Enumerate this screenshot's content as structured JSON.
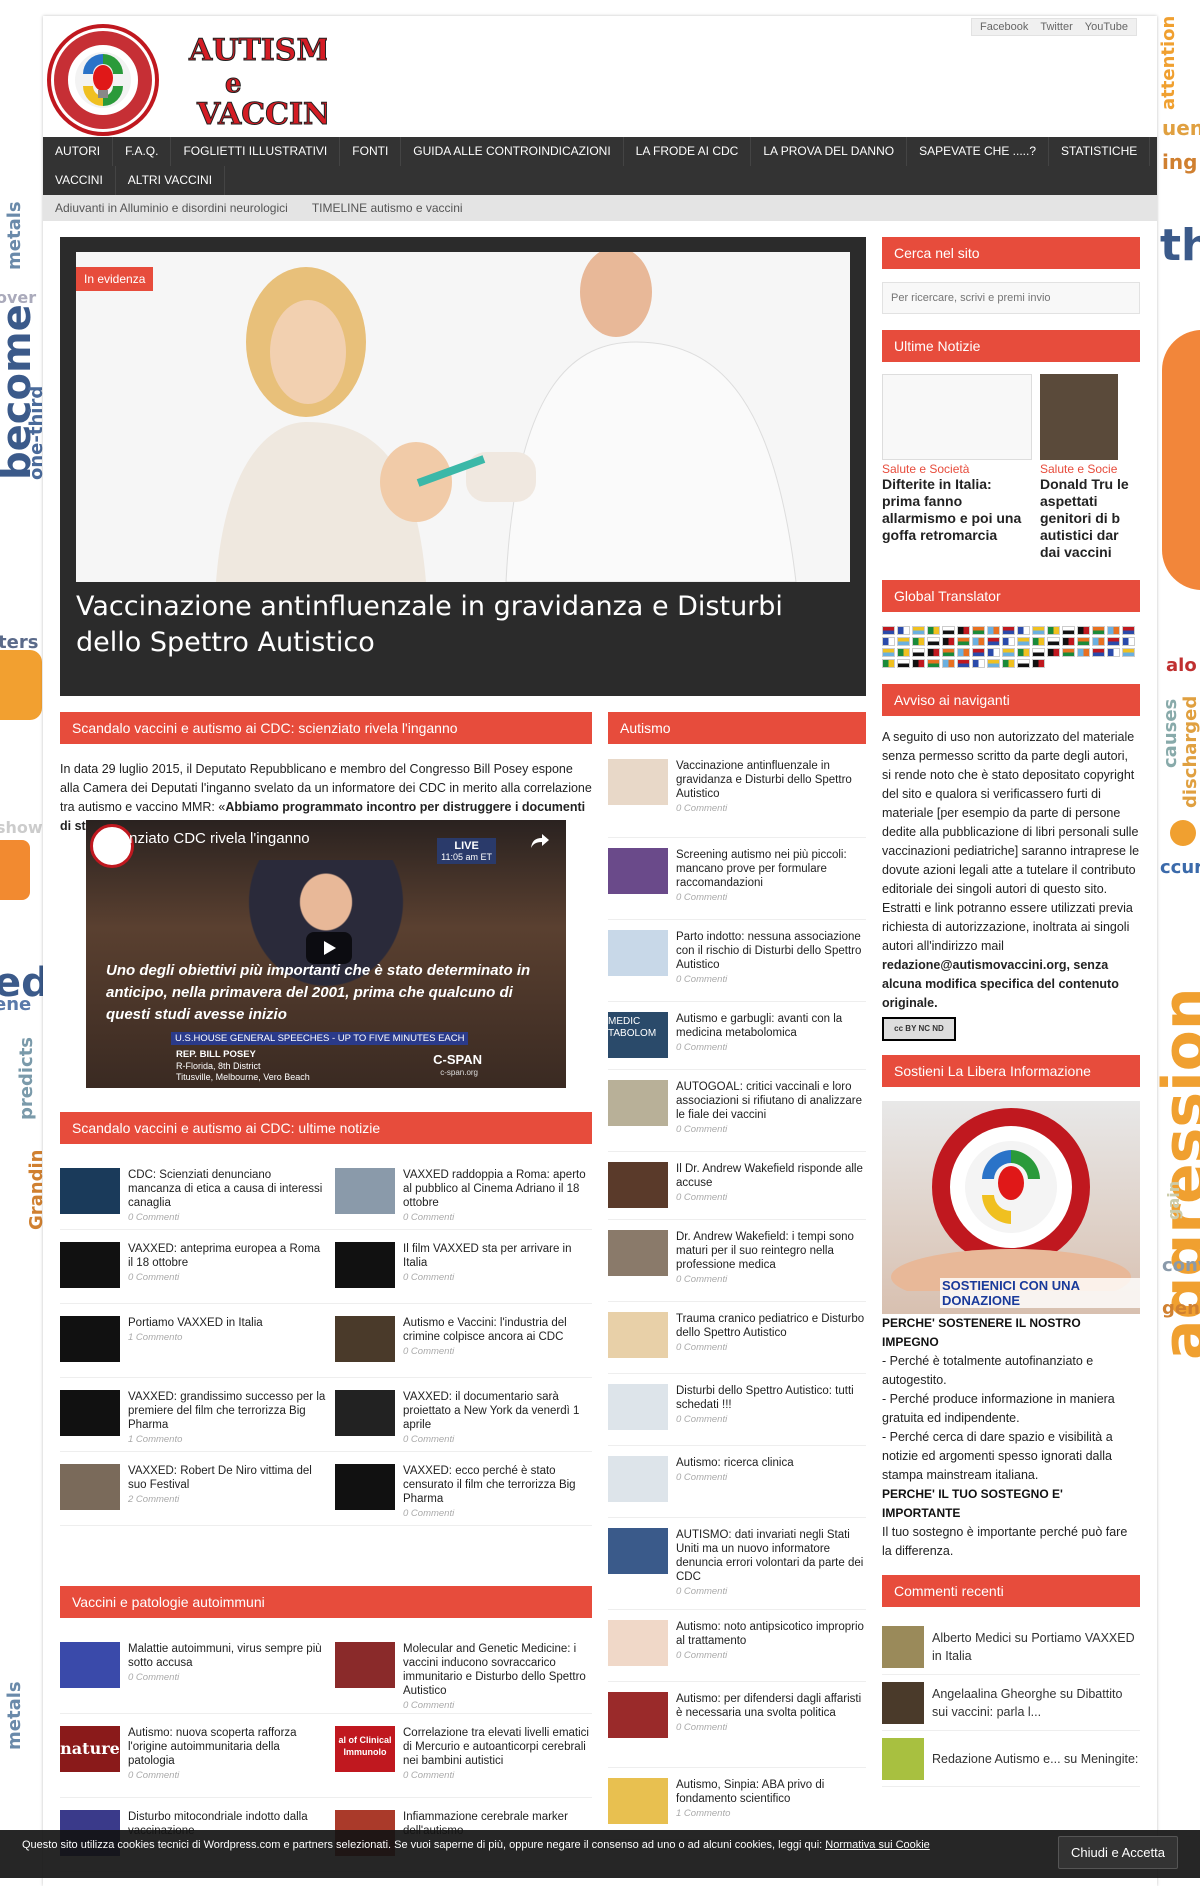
{
  "background_words": [
    "attention",
    "become",
    "one-third",
    "metals",
    "over",
    "causes",
    "discharged",
    "aggression",
    "show",
    "ters",
    "ene",
    "predicts",
    "Grandin",
    "show",
    "alo",
    "gen",
    "convi",
    "ccur",
    "ed",
    "gain",
    "metals",
    "the",
    "ing",
    "uent"
  ],
  "header": {
    "social": [
      "Facebook",
      "Twitter",
      "YouTube"
    ],
    "logo": {
      "title_line1": "AUTISMO",
      "title_line2": "e",
      "title_line3": "VACCINI",
      "ring_text": "MOVIMENTO CONTRO AUTISMO"
    }
  },
  "nav": {
    "row1": [
      "AUTORI",
      "F.A.Q.",
      "FOGLIETTI ILLUSTRATIVI",
      "FONTI",
      "GUIDA ALLE CONTROINDICAZIONI",
      "LA FRODE AI CDC",
      "LA PROVA DEL DANNO",
      "SAPEVATE CHE .....?",
      "STATISTICHE"
    ],
    "row2": [
      "VACCINI",
      "ALTRI VACCINI"
    ],
    "sub": [
      "Adiuvanti in Alluminio e disordini neurologici",
      "TIMELINE autismo e vaccini"
    ]
  },
  "hero": {
    "badge": "In evidenza",
    "title": "Vaccinazione antinfluenzale in gravidanza e Disturbi dello Spettro Autistico"
  },
  "cdc_section": {
    "heading": "Scandalo vaccini e autismo ai CDC: scienziato rivela l'inganno",
    "paragraph_plain": "In data 29 luglio 2015, il Deputato Repubblicano e membro del Congresso Bill Posey espone alla Camera dei Deputati l'inganno svelato da un informatore dei CDC in merito alla correlazione tra autismo e vaccino MMR: «",
    "paragraph_bold": "Abbiamo programmato incontro per distruggere i documenti di studio vaccino autismo",
    "paragraph_end": "»",
    "video": {
      "title": "Scienziato CDC rivela l'inganno",
      "live": "LIVE",
      "live_time": "11:05 am ET",
      "quote": "Uno degli obiettivi più importanti che è stato determinato in anticipo, nella primavera del 2001, prima che qualcuno di questi studi avesse inizio",
      "banner": "U.S.HOUSE GENERAL SPEECHES - UP TO FIVE MINUTES EACH",
      "speaker": "REP. BILL POSEY",
      "district": "R-Florida, 8th District",
      "cities": "Titusville, Melbourne, Vero Beach",
      "network": "C-SPAN",
      "network_url": "c-span.org"
    }
  },
  "cdc_news": {
    "heading": "Scandalo vaccini e autismo ai CDC: ultime notizie",
    "items": [
      {
        "title": "CDC: Scienziati denunciano mancanza di etica a causa di interessi canaglia",
        "comments": "0 Commenti"
      },
      {
        "title": "VAXXED raddoppia a Roma: aperto al pubblico al Cinema Adriano il 18 ottobre",
        "comments": "0 Commenti"
      },
      {
        "title": "VAXXED: anteprima europea a Roma il 18 ottobre",
        "comments": "0 Commenti"
      },
      {
        "title": "Il film VAXXED sta per arrivare in Italia",
        "comments": "0 Commenti"
      },
      {
        "title": "Portiamo VAXXED in Italia",
        "comments": "1 Commento"
      },
      {
        "title": "Autismo e Vaccini: l'industria del crimine colpisce ancora ai CDC",
        "comments": "0 Commenti"
      },
      {
        "title": "VAXXED: grandissimo successo per la premiere del film che terrorizza Big Pharma",
        "comments": "1 Commento"
      },
      {
        "title": "VAXXED: il documentario sarà proiettato a New York da venerdì 1 aprile",
        "comments": "0 Commenti"
      },
      {
        "title": "VAXXED: Robert De Niro vittima del suo Festival",
        "comments": "2 Commenti"
      },
      {
        "title": "VAXXED: ecco perché è stato censurato il film che terrorizza Big Pharma",
        "comments": "0 Commenti"
      }
    ]
  },
  "autoimmune": {
    "heading": "Vaccini e patologie autoimmuni",
    "items": [
      {
        "title": "Malattie autoimmuni, virus sempre più sotto accusa",
        "comments": "0 Commenti"
      },
      {
        "title": "Molecular and Genetic Medicine: i vaccini inducono sovraccarico immunitario e Disturbo dello Spettro Autistico",
        "comments": "0 Commenti"
      },
      {
        "title": "Autismo: nuova scoperta rafforza l'origine autoimmunitaria della patologia",
        "comments": "0 Commenti",
        "thumb_text": "nature"
      },
      {
        "title": "Correlazione tra elevati livelli ematici di Mercurio e autoanticorpi cerebrali nei bambini autistici",
        "comments": "0 Commenti",
        "thumb_text": "al of Clinical Immunolo"
      },
      {
        "title": "Disturbo mitocondriale indotto dalla vaccinazione",
        "comments": ""
      },
      {
        "title": "Infiammazione cerebrale marker dell'autismo",
        "comments": ""
      }
    ]
  },
  "autism": {
    "heading": "Autismo",
    "items": [
      {
        "title": "Vaccinazione antinfluenzale in gravidanza e Disturbi dello Spettro Autistico",
        "comments": "0 Commenti"
      },
      {
        "title": "Screening autismo nei più piccoli: mancano prove per formulare raccomandazioni",
        "comments": "0 Commenti"
      },
      {
        "title": "Parto indotto: nessuna associazione con il rischio di Disturbi dello Spettro Autistico",
        "comments": "0 Commenti"
      },
      {
        "title": "Autismo e garbugli: avanti con la medicina metabolomica",
        "comments": "0 Commenti",
        "thumb_text": "MEDIC TABOLOM"
      },
      {
        "title": "AUTOGOAL: critici vaccinali e loro associazioni si rifiutano di analizzare le fiale dei vaccini",
        "comments": "0 Commenti"
      },
      {
        "title": "Il Dr. Andrew Wakefield risponde alle accuse",
        "comments": "0 Commenti"
      },
      {
        "title": "Dr. Andrew Wakefield: i tempi sono maturi per il suo reintegro nella professione medica",
        "comments": "0 Commenti"
      },
      {
        "title": "Trauma cranico pediatrico e Disturbo dello Spettro Autistico",
        "comments": "0 Commenti"
      },
      {
        "title": "Disturbi dello Spettro Autistico: tutti schedati !!!",
        "comments": "0 Commenti"
      },
      {
        "title": "Autismo: ricerca clinica",
        "comments": "0 Commenti"
      },
      {
        "title": "AUTISMO: dati invariati negli Stati Uniti ma un nuovo informatore denuncia errori volontari da parte dei CDC",
        "comments": "0 Commenti"
      },
      {
        "title": "Autismo: noto antipsicotico improprio al trattamento",
        "comments": "0 Commenti"
      },
      {
        "title": "Autismo: per difendersi dagli affaristi è necessaria una svolta politica",
        "comments": "0 Commenti"
      },
      {
        "title": "Autismo, Sinpia: ABA privo di fondamento scientifico",
        "comments": "1 Commento"
      }
    ]
  },
  "sidebar": {
    "search": {
      "heading": "Cerca nel sito",
      "placeholder": "Per ricercare, scrivi e premi invio"
    },
    "latest": {
      "heading": "Ultime Notizie",
      "items": [
        {
          "category": "Salute e Società",
          "title": "Difterite in Italia: prima fanno allarmismo e poi una goffa retromarcia"
        },
        {
          "category": "Salute e Socie",
          "title": "Donald Tru le aspettati genitori di b autistici dar dai vaccini"
        }
      ]
    },
    "translator": {
      "heading": "Global Translator"
    },
    "notice": {
      "heading": "Avviso ai naviganti",
      "text": "A seguito di uso non autorizzato del materiale senza permesso scritto da parte degli autori, si rende noto che è stato depositato copyright del sito e qualora si verificassero furti di materiale [per esempio da parte di persone dedite alla pubblicazione di libri personali sulle vaccinazioni pediatriche] saranno intraprese le dovute azioni legali atte a tutelare il contributo editoriale dei singoli autori di questo sito.",
      "text2": "Estratti e link potranno essere utilizzati previa richiesta di autorizzazione, inoltrata ai singoli autori all'indirizzo mail ",
      "text_bold": "redazione@autismovaccini.org, senza alcuna modifica specifica del contenuto originale.",
      "license": "cc BY NC ND"
    },
    "support": {
      "heading": "Sostieni La Libera Informazione",
      "donate_banner": "SOSTIENICI CON UNA DONAZIONE",
      "why_heading": "PERCHE' SOSTENERE IL NOSTRO IMPEGNO",
      "reasons": [
        "- Perché è totalmente autofinanziato e autogestito.",
        "- Perché produce informazione in maniera gratuita ed indipendente.",
        "- Perché cerca di dare spazio e visibilità a notizie ed argomenti spesso ignorati dalla stampa mainstream italiana."
      ],
      "important_heading": "PERCHE' IL TUO SOSTEGNO E' IMPORTANTE",
      "important_text": "Il tuo sostegno è importante perché può fare la differenza."
    },
    "comments": {
      "heading": "Commenti recenti",
      "items": [
        "Alberto Medici su Portiamo VAXXED in Italia",
        "Angelaalina Gheorghe su Dibattito sui vaccini: parla l...",
        "Redazione Autismo e... su Meningite:"
      ]
    }
  },
  "cookie": {
    "text": "Questo sito utilizza cookies tecnici di Wordpress.com e partners selezionati. Se vuoi saperne di più, oppure negare il consenso ad uno o ad alcuni cookies, leggi qui: ",
    "link": "Normativa sui Cookie",
    "button": "Chiudi e Accetta"
  },
  "colors": {
    "accent": "#e74c3c",
    "nav": "#333333",
    "subnav": "#e4e4e4"
  }
}
